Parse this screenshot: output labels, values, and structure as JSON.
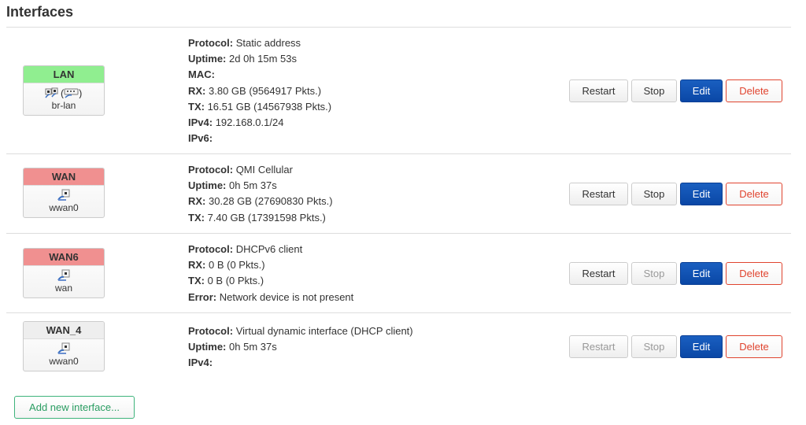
{
  "page": {
    "title": "Interfaces"
  },
  "interfaces": [
    {
      "name": "LAN",
      "header_color": "#90ee90",
      "device": "br-lan",
      "icons": [
        "bridge-icon",
        "wireless-icon"
      ],
      "details": [
        {
          "label": "Protocol:",
          "value": "Static address"
        },
        {
          "label": "Uptime:",
          "value": "2d 0h 15m 53s"
        },
        {
          "label": "MAC:",
          "value": ""
        },
        {
          "label": "RX:",
          "value": "3.80 GB (9564917 Pkts.)"
        },
        {
          "label": "TX:",
          "value": "16.51 GB (14567938 Pkts.)"
        },
        {
          "label": "IPv4:",
          "value": "192.168.0.1/24"
        },
        {
          "label": "IPv6:",
          "value": ""
        }
      ],
      "buttons": {
        "restart": "Restart",
        "stop": "Stop",
        "edit": "Edit",
        "delete": "Delete"
      },
      "restart_enabled": true,
      "stop_enabled": true
    },
    {
      "name": "WAN",
      "header_color": "#f09090",
      "device": "wwan0",
      "icons": [
        "ethernet-port-icon"
      ],
      "details": [
        {
          "label": "Protocol:",
          "value": "QMI Cellular"
        },
        {
          "label": "Uptime:",
          "value": "0h 5m 37s"
        },
        {
          "label": "RX:",
          "value": "30.28 GB (27690830 Pkts.)"
        },
        {
          "label": "TX:",
          "value": "7.40 GB (17391598 Pkts.)"
        }
      ],
      "buttons": {
        "restart": "Restart",
        "stop": "Stop",
        "edit": "Edit",
        "delete": "Delete"
      },
      "restart_enabled": true,
      "stop_enabled": true
    },
    {
      "name": "WAN6",
      "header_color": "#f09090",
      "device": "wan",
      "icons": [
        "ethernet-port-icon"
      ],
      "details": [
        {
          "label": "Protocol:",
          "value": "DHCPv6 client"
        },
        {
          "label": "RX:",
          "value": "0 B (0 Pkts.)"
        },
        {
          "label": "TX:",
          "value": "0 B (0 Pkts.)"
        },
        {
          "label": "Error:",
          "value": "Network device is not present"
        }
      ],
      "buttons": {
        "restart": "Restart",
        "stop": "Stop",
        "edit": "Edit",
        "delete": "Delete"
      },
      "restart_enabled": true,
      "stop_enabled": false
    },
    {
      "name": "WAN_4",
      "header_color": "#eeeeee",
      "device": "wwan0",
      "icons": [
        "ethernet-port-icon"
      ],
      "details": [
        {
          "label": "Protocol:",
          "value": "Virtual dynamic interface (DHCP client)"
        },
        {
          "label": "Uptime:",
          "value": "0h 5m 37s"
        },
        {
          "label": "IPv4:",
          "value": ""
        }
      ],
      "buttons": {
        "restart": "Restart",
        "stop": "Stop",
        "edit": "Edit",
        "delete": "Delete"
      },
      "restart_enabled": false,
      "stop_enabled": false
    }
  ],
  "footer": {
    "add_label": "Add new interface..."
  }
}
